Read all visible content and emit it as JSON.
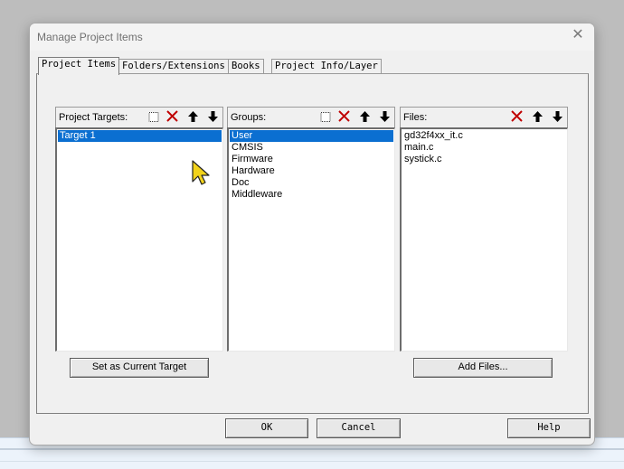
{
  "dialog": {
    "title": "Manage Project Items",
    "close_glyph": "✕"
  },
  "tabs": [
    {
      "label": "Project Items",
      "active": true
    },
    {
      "label": "Folders/Extensions",
      "active": false
    },
    {
      "label": "Books",
      "active": false
    },
    {
      "label": "Project Info/Layer",
      "active": false
    }
  ],
  "targets_pane": {
    "label": "Project Targets:",
    "tools": [
      "new-icon",
      "delete-icon",
      "move-up-icon",
      "move-down-icon"
    ],
    "items": [
      {
        "label": "Target 1",
        "selected": true
      }
    ],
    "button_label": "Set as Current Target"
  },
  "groups_pane": {
    "label": "Groups:",
    "tools": [
      "new-icon",
      "delete-icon",
      "move-up-icon",
      "move-down-icon"
    ],
    "items": [
      {
        "label": "User",
        "selected": true
      },
      {
        "label": "CMSIS",
        "selected": false
      },
      {
        "label": "Firmware",
        "selected": false
      },
      {
        "label": "Hardware",
        "selected": false
      },
      {
        "label": "Doc",
        "selected": false
      },
      {
        "label": "Middleware",
        "selected": false
      }
    ]
  },
  "files_pane": {
    "label": "Files:",
    "tools": [
      "delete-icon",
      "move-up-icon",
      "move-down-icon"
    ],
    "items": [
      {
        "label": "gd32f4xx_it.c",
        "selected": false
      },
      {
        "label": "main.c",
        "selected": false
      },
      {
        "label": "systick.c",
        "selected": false
      }
    ],
    "button_label": "Add Files..."
  },
  "footer": {
    "ok_label": "OK",
    "cancel_label": "Cancel",
    "help_label": "Help"
  },
  "colors": {
    "selection": "#0b6fd1",
    "delete_icon": "#c00000",
    "cursor": "#f2d31b"
  }
}
